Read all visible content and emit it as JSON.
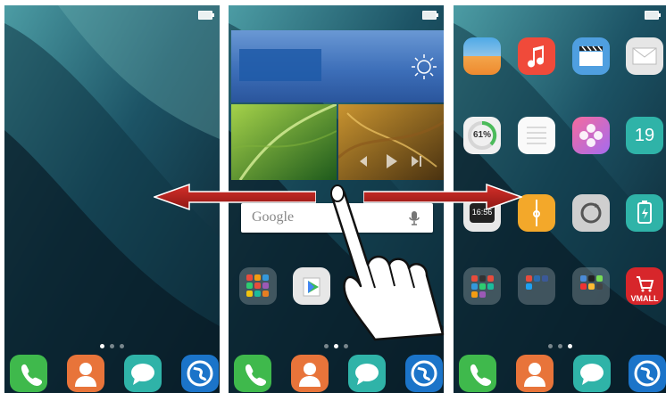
{
  "screens": [
    {
      "id": "left",
      "page_indicator": {
        "count": 3,
        "active": 0
      }
    },
    {
      "id": "center",
      "page_indicator": {
        "count": 3,
        "active": 1
      },
      "search": {
        "placeholder": "Google"
      },
      "widgets": [
        "weather-widget",
        "photo-widget-leaf",
        "photo-widget-music"
      ]
    },
    {
      "id": "right",
      "page_indicator": {
        "count": 3,
        "active": 2
      },
      "apps": {
        "storage_percent": "61%",
        "clock_time": "16:56",
        "calendar_day": "19",
        "store_label": "VMALL"
      }
    }
  ],
  "dock": [
    "phone-icon",
    "contacts-icon",
    "messages-icon",
    "browser-icon"
  ],
  "gesture": {
    "direction": "left-and-right",
    "arrow_color": "#b8221e"
  },
  "colors": {
    "wallpaper_dark": "#0b2531",
    "wallpaper_teal": "#3e8590",
    "dock_green": "#3fb94c",
    "dock_orange": "#e8743a",
    "dock_teal": "#2fb3a8",
    "dock_blue": "#1b74c9"
  }
}
